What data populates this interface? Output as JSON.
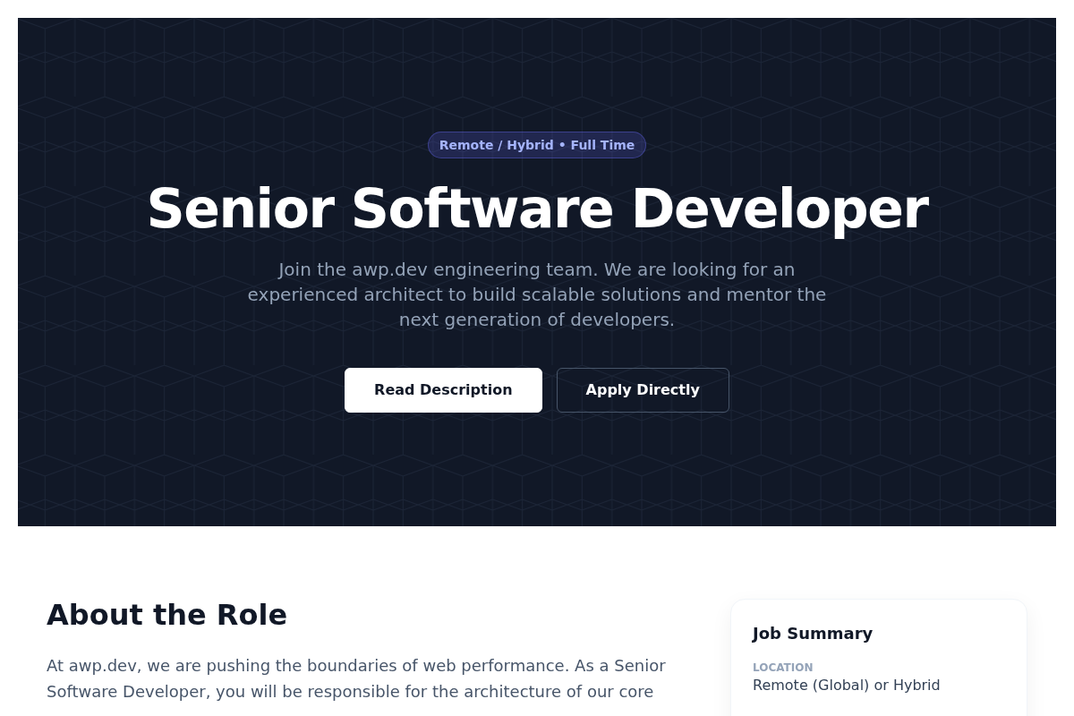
{
  "hero": {
    "badge": "Remote / Hybrid • Full Time",
    "title": "Senior Software Developer",
    "subtitle": "Join the awp.dev engineering team. We are looking for an experienced architect to build scalable solutions and mentor the next generation of developers.",
    "buttons": [
      {
        "label": "Read Description",
        "kind": "primary"
      },
      {
        "label": "Apply Directly",
        "kind": "outline"
      }
    ]
  },
  "about": {
    "heading": "About the Role",
    "paragraph": "At awp.dev, we are pushing the boundaries of web performance. As a Senior Software Developer, you will be responsible for the architecture of our core"
  },
  "job_summary": {
    "title": "Job Summary",
    "fields": [
      {
        "label": "LOCATION",
        "value": "Remote (Global) or Hybrid"
      }
    ]
  }
}
